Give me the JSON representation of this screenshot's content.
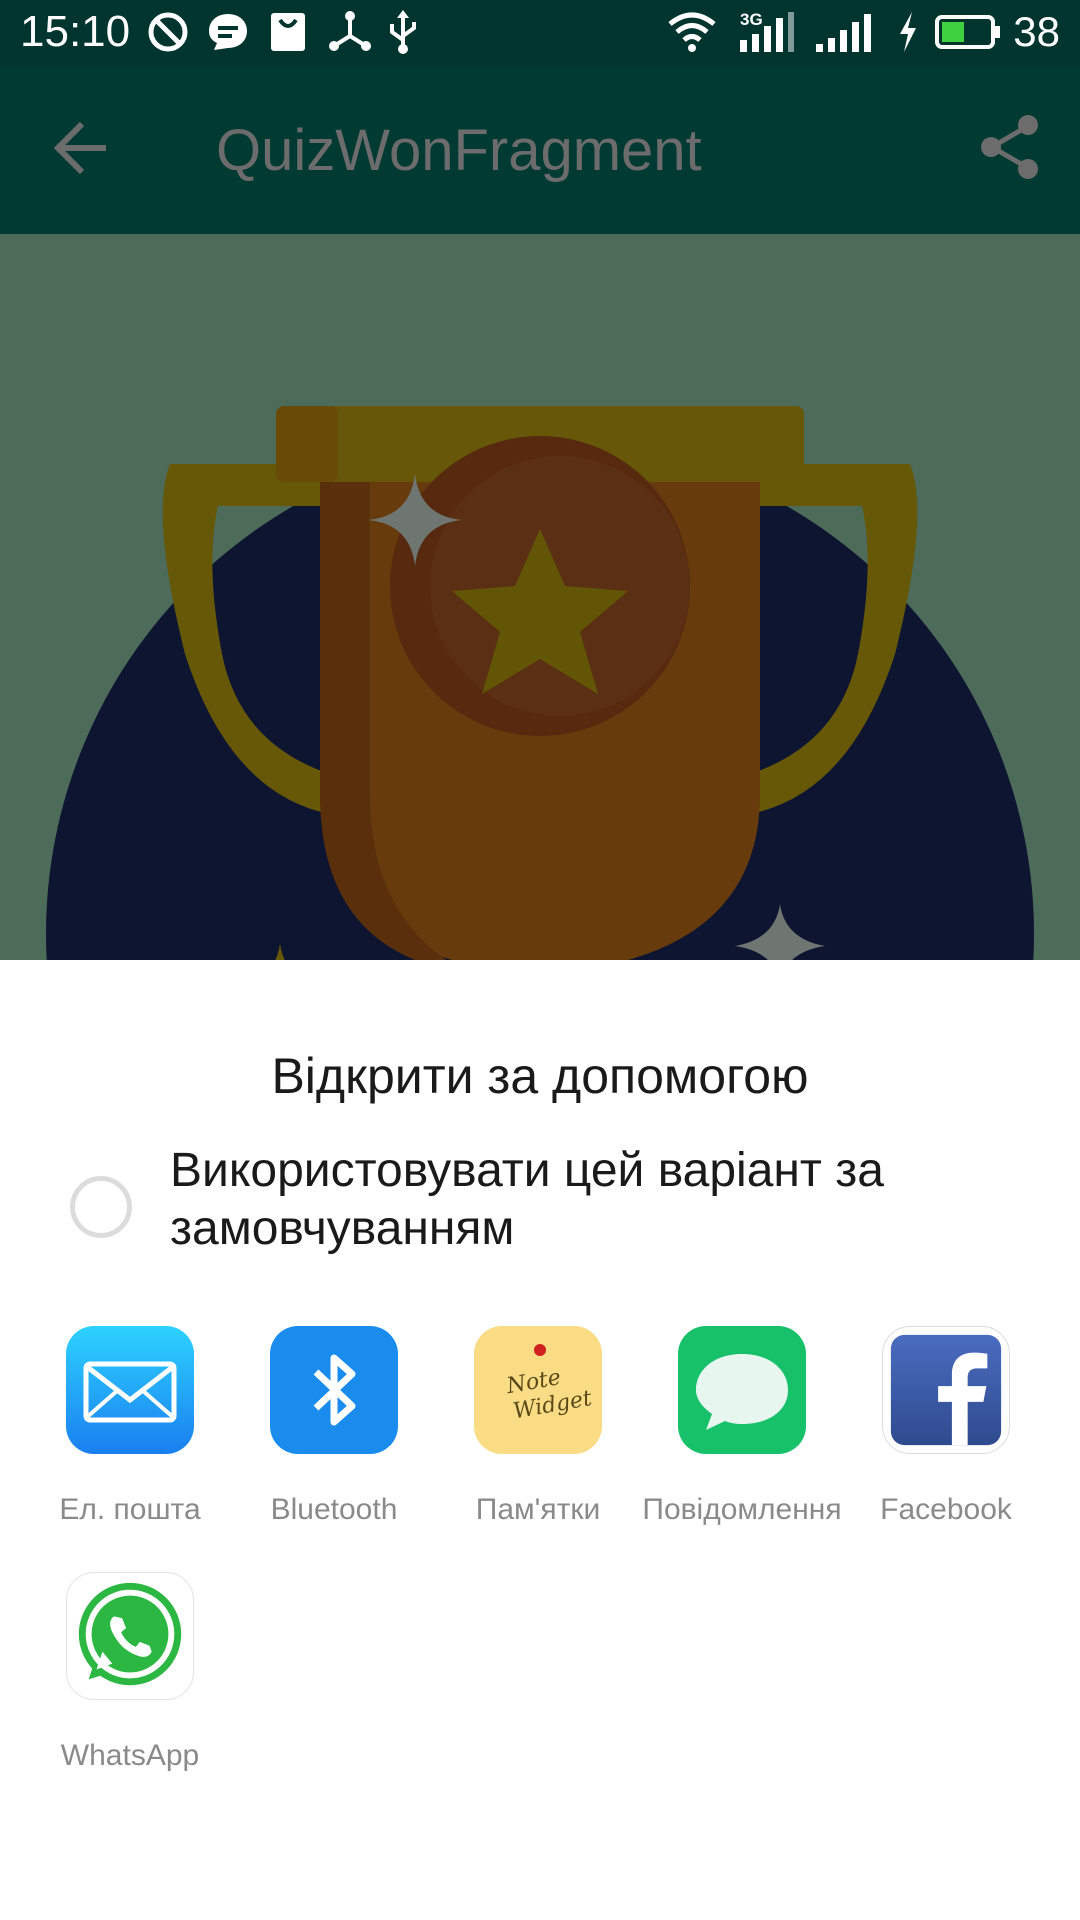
{
  "status_bar": {
    "time": "15:10",
    "network_type": "3G",
    "battery_level": "38",
    "icons": [
      "do-not-disturb-icon",
      "chat-bubble-icon",
      "bag-icon",
      "network-share-icon",
      "usb-icon",
      "wifi-icon",
      "signal-3g-icon",
      "signal-icon",
      "charging-icon",
      "battery-icon"
    ]
  },
  "app_bar": {
    "title": "QuizWonFragment",
    "back_icon": "arrow-back-icon",
    "share_icon": "share-icon"
  },
  "sheet": {
    "title": "Відкрити за допомогою",
    "default_option": {
      "label": "Використовувати цей варіант за замовчуванням",
      "checked": false
    },
    "apps": [
      {
        "label": "Ел. пошта",
        "icon": "mail-icon",
        "color": "#1ea6f7"
      },
      {
        "label": "Bluetooth",
        "icon": "bluetooth-icon",
        "color": "#1a8cee"
      },
      {
        "label": "Пам'ятки",
        "icon": "note-widget-icon",
        "color": "#f9dc83"
      },
      {
        "label": "Повідомлення",
        "icon": "messages-icon",
        "color": "#16c16a"
      },
      {
        "label": "Facebook",
        "icon": "facebook-icon",
        "color": "#3b5898"
      },
      {
        "label": "WhatsApp",
        "icon": "whatsapp-icon",
        "color": "#2bb741"
      }
    ]
  },
  "colors": {
    "status_bar": "#00352f",
    "app_bar": "#013a33",
    "scrim_background": "#4d6b59"
  }
}
